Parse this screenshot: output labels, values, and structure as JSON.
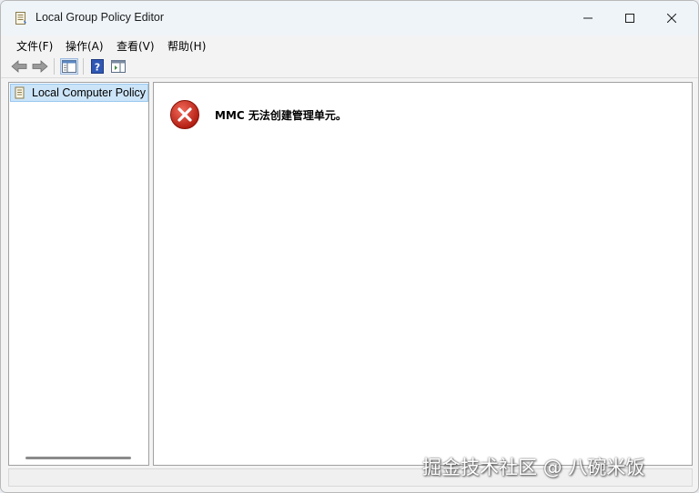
{
  "window": {
    "title": "Local Group Policy Editor"
  },
  "menu": [
    {
      "label": "文件(F)"
    },
    {
      "label": "操作(A)"
    },
    {
      "label": "查看(V)"
    },
    {
      "label": "帮助(H)"
    }
  ],
  "tree": {
    "root_label": "Local Computer Policy"
  },
  "content": {
    "error_message": "MMC 无法创建管理单元。"
  },
  "watermark": "掘金技术社区 @ 八碗米饭",
  "colors": {
    "selection": "#cce4f7",
    "error_red": "#c42b1c"
  }
}
